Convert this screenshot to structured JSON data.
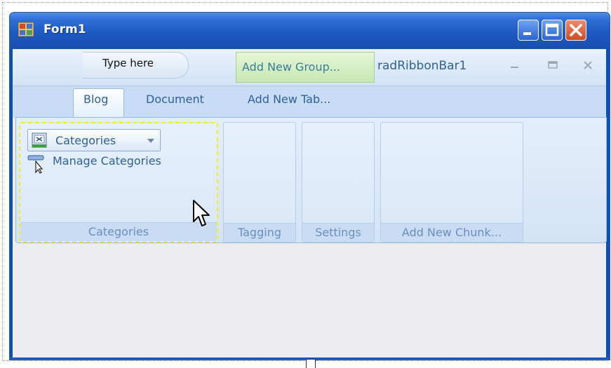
{
  "window": {
    "title": "Form1"
  },
  "ribbon": {
    "quick_access_placeholder": "Type here",
    "add_new_group_label": "Add New Group...",
    "caption": "radRibbonBar1",
    "tabs": [
      {
        "label": "Blog",
        "active": true
      },
      {
        "label": "Document",
        "active": false
      },
      {
        "label": "Add New Tab...",
        "active": false
      }
    ],
    "groups": [
      {
        "label": "Categories",
        "items": [
          {
            "label": "Categories",
            "type": "dropdown"
          },
          {
            "label": "Manage Categories",
            "type": "button"
          }
        ]
      },
      {
        "label": "Tagging"
      },
      {
        "label": "Settings"
      },
      {
        "label": "Add New Chunk..."
      }
    ]
  },
  "colors": {
    "title_bar": "#1d59c2",
    "ribbon_text": "#2e5fa0",
    "group_label_text": "#6a8fbf",
    "selection_outline": "#f3ee24",
    "add_group_bg": "#c6e8b2"
  },
  "icons": [
    "form-icon",
    "minimize-icon",
    "maximize-icon",
    "close-icon",
    "app-menu-icon",
    "category-icon",
    "manage-categories-icon",
    "mouse-cursor-icon"
  ]
}
